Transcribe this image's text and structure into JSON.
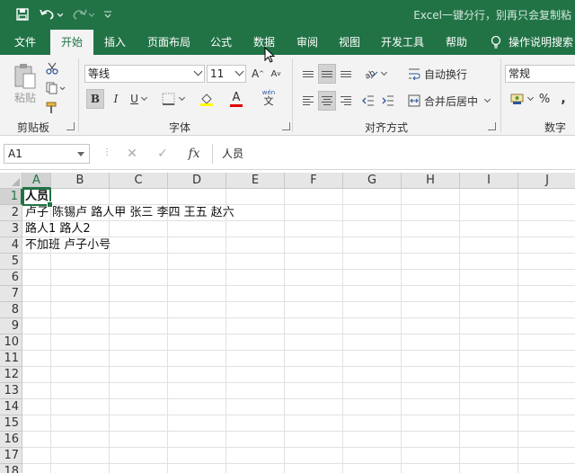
{
  "window": {
    "title": "Excel一键分行，别再只会复制粘"
  },
  "tabs": [
    {
      "label": "文件",
      "active": false
    },
    {
      "label": "开始",
      "active": true
    },
    {
      "label": "插入",
      "active": false
    },
    {
      "label": "页面布局",
      "active": false
    },
    {
      "label": "公式",
      "active": false
    },
    {
      "label": "数据",
      "active": false
    },
    {
      "label": "审阅",
      "active": false
    },
    {
      "label": "视图",
      "active": false
    },
    {
      "label": "开发工具",
      "active": false
    },
    {
      "label": "帮助",
      "active": false
    }
  ],
  "tell_me": "操作说明搜索",
  "ribbon": {
    "clipboard": {
      "paste_label": "粘贴",
      "group_label": "剪贴板"
    },
    "font": {
      "group_label": "字体",
      "font_name": "等线",
      "font_size": "11",
      "grow_label": "A",
      "shrink_label": "A",
      "bold_label": "B",
      "italic_label": "I",
      "underline_label": "U",
      "font_color_label": "A",
      "phonetic_top": "wén",
      "phonetic_bottom": "文"
    },
    "alignment": {
      "group_label": "对齐方式",
      "wrap_text": "自动换行",
      "merge_center": "合并后居中"
    },
    "number": {
      "group_label": "数字",
      "format": "常规",
      "percent_label": "%"
    }
  },
  "formula_bar": {
    "name_box": "A1",
    "cancel_symbol": "✕",
    "enter_symbol": "✓",
    "fx_label": "fx",
    "formula": "人员"
  },
  "sheet": {
    "columns": [
      "A",
      "B",
      "C",
      "D",
      "E",
      "F",
      "G",
      "H",
      "I",
      "J"
    ],
    "rows": [
      "1",
      "2",
      "3",
      "4",
      "5",
      "6",
      "7",
      "8",
      "9",
      "10",
      "11",
      "12",
      "13",
      "14",
      "15",
      "16",
      "17",
      "18"
    ],
    "cells": [
      {
        "row": "1",
        "col": "A",
        "text": "人员",
        "bold": true
      },
      {
        "row": "2",
        "col": "A",
        "text": "卢子 陈锡卢 路人甲 张三 李四 王五 赵六",
        "bold": false
      },
      {
        "row": "3",
        "col": "A",
        "text": "路人1 路人2",
        "bold": false
      },
      {
        "row": "4",
        "col": "A",
        "text": "不加班 卢子小号",
        "bold": false
      }
    ],
    "selected": "A1"
  },
  "colors": {
    "brand": "#217346",
    "ribbon_bg": "#f3f3f3",
    "font_color_bar": "#e00000",
    "fill_color_bar": "#ffff00"
  }
}
